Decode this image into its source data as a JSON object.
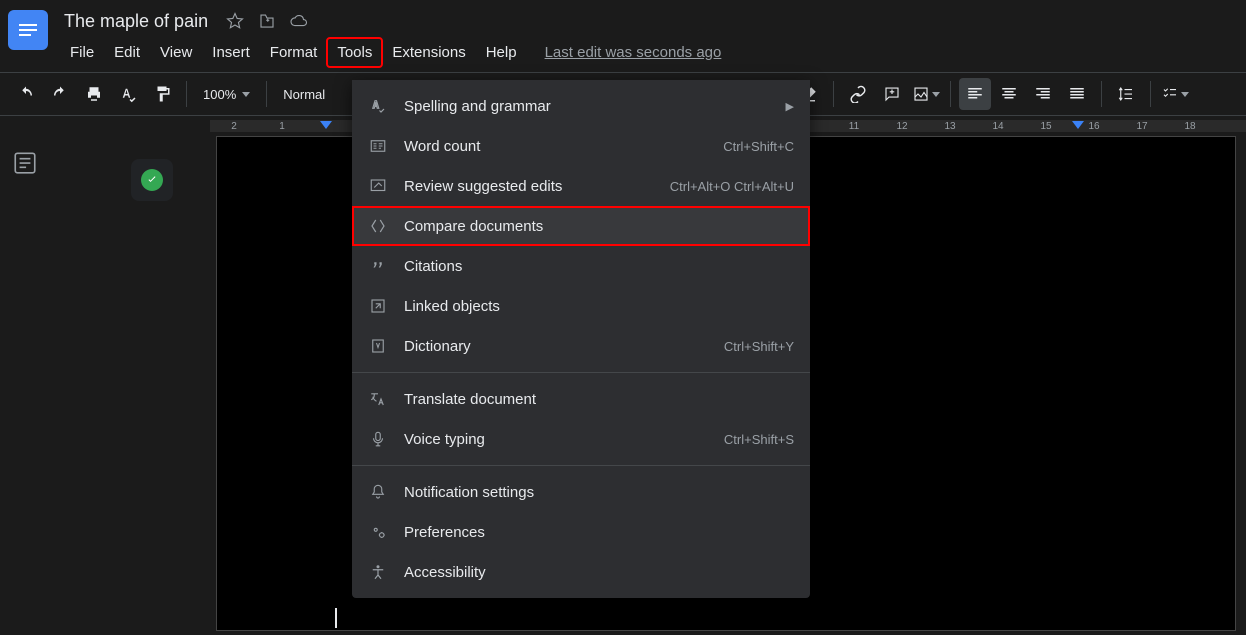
{
  "header": {
    "doc_title": "The maple of pain",
    "menubar": [
      "File",
      "Edit",
      "View",
      "Insert",
      "Format",
      "Tools",
      "Extensions",
      "Help"
    ],
    "last_edit": "Last edit was seconds ago"
  },
  "toolbar": {
    "zoom": "100%",
    "style": "Normal"
  },
  "ruler": {
    "left_ticks": [
      "2",
      "1"
    ],
    "right_ticks": [
      "11",
      "12",
      "13",
      "14",
      "15",
      "16",
      "17",
      "18"
    ]
  },
  "dropdown": {
    "items": [
      {
        "icon": "spellcheck",
        "label": "Spelling and grammar",
        "shortcut": "",
        "arrow": true
      },
      {
        "icon": "wordcount",
        "label": "Word count",
        "shortcut": "Ctrl+Shift+C"
      },
      {
        "icon": "review",
        "label": "Review suggested edits",
        "shortcut": "Ctrl+Alt+O Ctrl+Alt+U"
      },
      {
        "icon": "compare",
        "label": "Compare documents",
        "shortcut": "",
        "highlighted": true,
        "hovered": true
      },
      {
        "icon": "citations",
        "label": "Citations",
        "shortcut": ""
      },
      {
        "icon": "linked",
        "label": "Linked objects",
        "shortcut": ""
      },
      {
        "icon": "dictionary",
        "label": "Dictionary",
        "shortcut": "Ctrl+Shift+Y"
      },
      {
        "sep": true
      },
      {
        "icon": "translate",
        "label": "Translate document",
        "shortcut": ""
      },
      {
        "icon": "voice",
        "label": "Voice typing",
        "shortcut": "Ctrl+Shift+S"
      },
      {
        "sep": true
      },
      {
        "icon": "bell",
        "label": "Notification settings",
        "shortcut": ""
      },
      {
        "icon": "prefs",
        "label": "Preferences",
        "shortcut": ""
      },
      {
        "icon": "access",
        "label": "Accessibility",
        "shortcut": ""
      }
    ]
  }
}
